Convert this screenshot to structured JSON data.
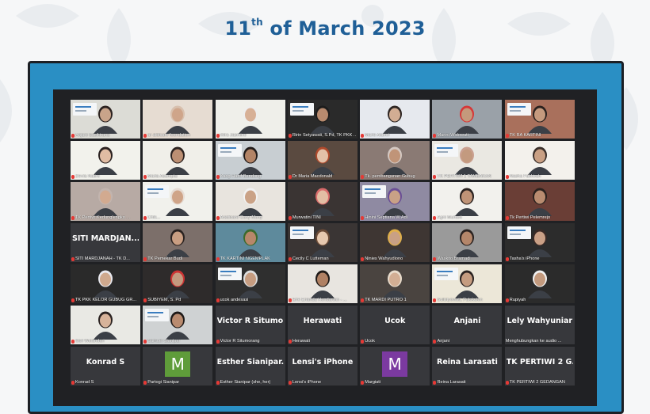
{
  "header": {
    "date_day": "11",
    "date_suffix": "th",
    "date_rest": " of March 2023"
  },
  "colors": {
    "title": "#1f5f97",
    "frame": "#2a8fc4",
    "screen": "#202124"
  },
  "participants": [
    {
      "type": "video",
      "label": "Anjani Sasikirana",
      "skin": "#c9a48a",
      "wall": "#dcdcd6",
      "hair": "#2b2220"
    },
    {
      "type": "video",
      "label": "ar aldicare foundation",
      "skin": "#cfa58a",
      "wall": "#e6dcd2",
      "hair": "#d8c0ae"
    },
    {
      "type": "video",
      "label": "Mira Jasmine",
      "skin": "#d7b096",
      "wall": "#efefea",
      "hair": "#eee"
    },
    {
      "type": "video",
      "label": "Ririn Setyawati, S.Pd, TK PKK ...",
      "skin": "#b88a6e",
      "wall": "#2a2a2a",
      "hair": "#1c1c1c"
    },
    {
      "type": "video",
      "label": "Marie Alamri",
      "skin": "#d2ad93",
      "wall": "#e6e9ee",
      "hair": "#2d2522"
    },
    {
      "type": "video",
      "label": "Marini Widowati",
      "skin": "#c4997c",
      "wall": "#9aa1a8",
      "hair": "#d63838"
    },
    {
      "type": "video",
      "label": "TK RA KARTINI",
      "skin": "#c59a7e",
      "wall": "#a9705c",
      "hair": "#2a211e"
    },
    {
      "type": "video",
      "label": "Devia Natiro",
      "skin": "#e0bca3",
      "wall": "#f2f2ec",
      "hair": "#2b2220"
    },
    {
      "type": "video",
      "label": "Maria Asumpta",
      "skin": "#bc8f73",
      "wall": "#f0efe9",
      "hair": "#2b2220"
    },
    {
      "type": "video",
      "label": "Kang Hanif Bandung",
      "skin": "#b38466",
      "wall": "#c8ced2",
      "hair": "#201a18"
    },
    {
      "type": "video",
      "label": "Dr Maria Macdonald",
      "skin": "#e3c1a8",
      "wall": "#5a4a40",
      "hair": "#b04a2c"
    },
    {
      "type": "video",
      "label": "Tk. pembangunan Gubug",
      "skin": "#c09478",
      "wall": "#8a7a74",
      "hair": "#d4c8c2"
    },
    {
      "type": "video",
      "label": "TK PERTIWI 1 TAMBAKAN",
      "skin": "#c39a7f",
      "wall": "#eae8e2",
      "hair": "#caa090"
    },
    {
      "type": "video",
      "label": "Nasha Fakhirah",
      "skin": "#c9a084",
      "wall": "#f3f1ec",
      "hair": "#3a2f2a"
    },
    {
      "type": "video",
      "label": "TK Pertiwi Kedunglengko ...",
      "skin": "#d2aa90",
      "wall": "#b7aaa4",
      "hair": "#c2b4ae"
    },
    {
      "type": "video",
      "label": "Chik...",
      "skin": "#cfa488",
      "wall": "#f1f1ec",
      "hair": "#e6dcd4"
    },
    {
      "type": "video",
      "label": "Arsdicare Cony Mony",
      "skin": "#caa286",
      "wall": "#e8e4de",
      "hair": "#f2f2f2"
    },
    {
      "type": "video",
      "label": "Murwatini TINI",
      "skin": "#e2bea4",
      "wall": "#3a3433",
      "hair": "#d86b6b"
    },
    {
      "type": "video",
      "label": "Hinini Septiana W.Adi",
      "skin": "#c9a186",
      "wall": "#8f8aa2",
      "hair": "#6a4e96"
    },
    {
      "type": "video",
      "label": "Agni Muharti",
      "skin": "#bf9377",
      "wall": "#f2f1ed",
      "hair": "#2a2220"
    },
    {
      "type": "video",
      "label": "Tk Pertiwi Pelemrejo",
      "skin": "#b98c70",
      "wall": "#6a3e36",
      "hair": "#2a211e"
    },
    {
      "type": "name",
      "big": "SITI MARDJAN...",
      "label": "SITI MARDJANAH - TK D..."
    },
    {
      "type": "video",
      "label": "TK Pemekar Budi",
      "skin": "#c99e82",
      "wall": "#7c6f6a",
      "hair": "#2a2220"
    },
    {
      "type": "video",
      "label": "TK KARTINI NGEMPLAK",
      "skin": "#b8876a",
      "wall": "#5e8a9c",
      "hair": "#3c6a2c"
    },
    {
      "type": "video",
      "label": "Cecily C Lutteman",
      "skin": "#e6c8ae",
      "wall": "#3a3534",
      "hair": "#6a4a36"
    },
    {
      "type": "video",
      "label": "Ninies Wahyudiono",
      "skin": "#c9a084",
      "wall": "#3e3633",
      "hair": "#e0b04a"
    },
    {
      "type": "video",
      "label": "Waskito Bramadi",
      "skin": "#b4866a",
      "wall": "#9a9a9a",
      "hair": "#2a2220"
    },
    {
      "type": "video",
      "label": "Tasha's iPhone",
      "skin": "#caa086",
      "wall": "#2c2c2c",
      "hair": "#3a2a26"
    },
    {
      "type": "video",
      "label": "TK PKK KELOR GUBUG GR...",
      "skin": "#cfa98e",
      "wall": "#2a2a2a",
      "hair": "#e8e8ee"
    },
    {
      "type": "video",
      "label": "SUBIYEM, S. Pd",
      "skin": "#c39a7f",
      "wall": "#2e2b2b",
      "hair": "#cc3333"
    },
    {
      "type": "video",
      "label": "ucok andesasi",
      "skin": "#c69c80",
      "wall": "#2f2f2f",
      "hair": "#ddd"
    },
    {
      "type": "video",
      "label": "Erie Erlanda Hendarwin - ...",
      "skin": "#b08164",
      "wall": "#e8e5e0",
      "hair": "#1e1a18"
    },
    {
      "type": "video",
      "label": "TK MARDI PUTRO 1",
      "skin": "#d2ae94",
      "wall": "#4a4440",
      "hair": "#e8dccc"
    },
    {
      "type": "video",
      "label": "Sulistyowati, Palokulon",
      "skin": "#c59c80",
      "wall": "#ece7d8",
      "hair": "#2a2220"
    },
    {
      "type": "video",
      "label": "Rupiyah",
      "skin": "#c39a7e",
      "wall": "#2b2b2b",
      "hair": "#f0f0f0"
    },
    {
      "type": "video",
      "label": "Sari Wulandari",
      "skin": "#d7b39a",
      "wall": "#e9e9e4",
      "hair": "#2a2220"
    },
    {
      "type": "video",
      "label": "Samuel Sianipar",
      "skin": "#b98b6f",
      "wall": "#cfd2d3",
      "hair": "#1e1a18"
    },
    {
      "type": "name",
      "big": "Victor R Situmo...",
      "label": "Victor R Situmorang"
    },
    {
      "type": "name",
      "big": "Herawati",
      "label": "Herawati"
    },
    {
      "type": "name",
      "big": "Ucok",
      "label": "Ucok"
    },
    {
      "type": "name",
      "big": "Anjani",
      "label": "Anjani"
    },
    {
      "type": "name",
      "big": "Lely Wahyuniar",
      "label": "Menghubungkan ke audio ..."
    },
    {
      "type": "name",
      "big": "Konrad S",
      "label": "Konrad S"
    },
    {
      "type": "avatar",
      "letter": "M",
      "color": "#5f9c3a",
      "label": "Partogi Sianipar"
    },
    {
      "type": "name",
      "big": "Esther Sianipar...",
      "label": "Esther Sianipar (she, her)"
    },
    {
      "type": "name",
      "big": "Lensi's iPhone",
      "label": "Lensi's iPhone"
    },
    {
      "type": "avatar",
      "letter": "M",
      "color": "#7b3aa0",
      "label": "Margiati"
    },
    {
      "type": "name",
      "big": "Reina Larasati",
      "label": "Reina Larasati"
    },
    {
      "type": "name",
      "big": "TK PERTIWI 2 G...",
      "label": "TK PERTIWI 2 GEDANGAN"
    }
  ]
}
